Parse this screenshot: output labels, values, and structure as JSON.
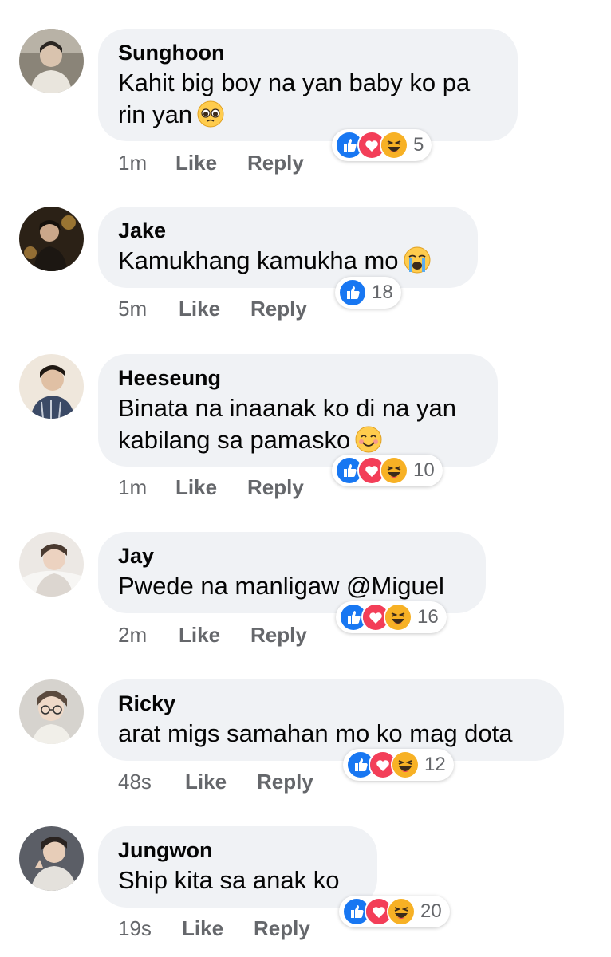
{
  "comments": [
    {
      "name": "Sunghoon",
      "lines": [
        "Kahit big boy na yan baby ko pa",
        "rin yan"
      ],
      "emoji": "pleading-face-emoji",
      "time": "1m",
      "like": "Like",
      "reply": "Reply",
      "reactions": [
        "like-reaction-icon",
        "love-reaction-icon",
        "haha-reaction-icon"
      ],
      "count": "5"
    },
    {
      "name": "Jake",
      "lines": [
        "Kamukhang kamukha mo"
      ],
      "emoji": "crying-face-emoji",
      "time": "5m",
      "like": "Like",
      "reply": "Reply",
      "reactions": [
        "like-reaction-icon"
      ],
      "count": "18"
    },
    {
      "name": "Heeseung",
      "lines": [
        "Binata na inaanak ko di na yan",
        "kabilang sa pamasko"
      ],
      "emoji": "smiling-face-emoji",
      "time": "1m",
      "like": "Like",
      "reply": "Reply",
      "reactions": [
        "like-reaction-icon",
        "love-reaction-icon",
        "haha-reaction-icon"
      ],
      "count": "10"
    },
    {
      "name": "Jay",
      "lines": [
        "Pwede na manligaw @Miguel"
      ],
      "emoji": "",
      "time": "2m",
      "like": "Like",
      "reply": "Reply",
      "reactions": [
        "like-reaction-icon",
        "love-reaction-icon",
        "haha-reaction-icon"
      ],
      "count": "16"
    },
    {
      "name": "Ricky",
      "lines": [
        "arat migs samahan mo ko mag dota"
      ],
      "emoji": "",
      "time": "48s",
      "like": "Like",
      "reply": "Reply",
      "reactions": [
        "like-reaction-icon",
        "love-reaction-icon",
        "haha-reaction-icon"
      ],
      "count": "12"
    },
    {
      "name": "Jungwon",
      "lines": [
        "Ship kita sa anak ko"
      ],
      "emoji": "",
      "time": "19s",
      "like": "Like",
      "reply": "Reply",
      "reactions": [
        "like-reaction-icon",
        "love-reaction-icon",
        "haha-reaction-icon"
      ],
      "count": "20"
    }
  ],
  "colors": {
    "bubble": "#f0f2f5",
    "meta_text": "#65676b",
    "like_blue": "#1877f2",
    "love_red": "#f33e58",
    "haha_yellow": "#f7b125"
  }
}
